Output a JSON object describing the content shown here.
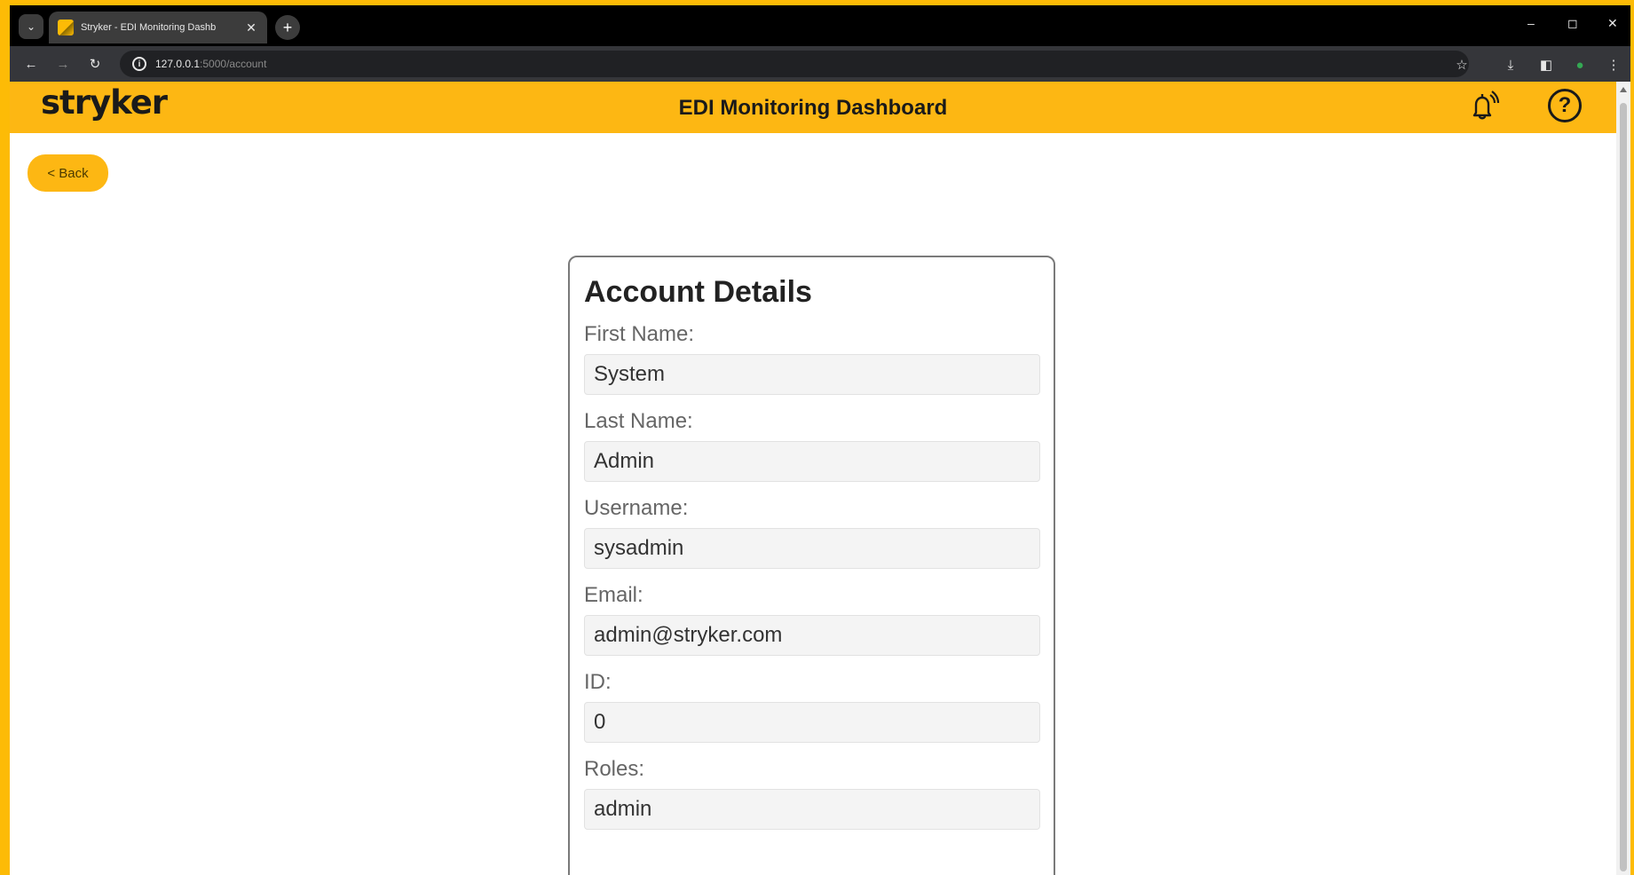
{
  "browser": {
    "tab_title": "Stryker - EDI Monitoring Dashb",
    "url_host": "127.0.0.1",
    "url_path": ":5000/account"
  },
  "header": {
    "logo": "stryker",
    "title": "EDI Monitoring Dashboard"
  },
  "back_label": "< Back",
  "account": {
    "title": "Account Details",
    "fields": [
      {
        "label": "First Name:",
        "value": "System"
      },
      {
        "label": "Last Name:",
        "value": "Admin"
      },
      {
        "label": "Username:",
        "value": "sysadmin"
      },
      {
        "label": "Email:",
        "value": "admin@stryker.com"
      },
      {
        "label": "ID:",
        "value": "0"
      },
      {
        "label": "Roles:",
        "value": "admin"
      }
    ]
  },
  "colors": {
    "brand": "#fdb713",
    "frame": "#fdbb06"
  },
  "icons": {
    "bell": "bell-ringing-icon",
    "help": "help-circle-icon"
  }
}
